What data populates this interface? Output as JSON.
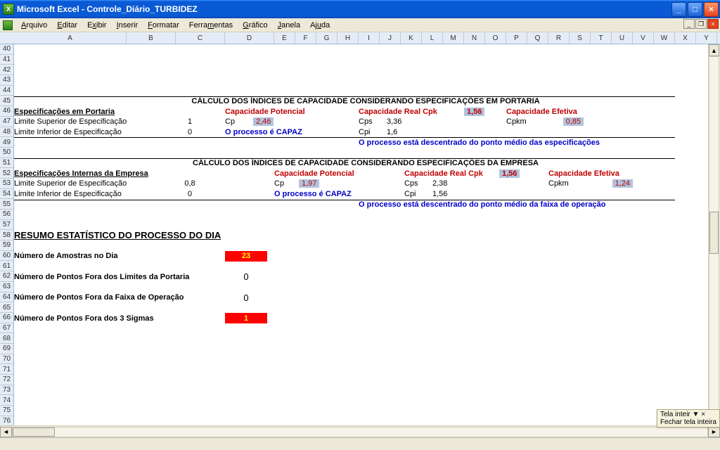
{
  "title": "Microsoft Excel - Controle_Diário_TURBIDEZ",
  "menus": [
    "Arquivo",
    "Editar",
    "Exibir",
    "Inserir",
    "Formatar",
    "Ferramentas",
    "Gráfico",
    "Janela",
    "Ajuda"
  ],
  "cols": [
    "A",
    "B",
    "C",
    "D",
    "E",
    "F",
    "G",
    "H",
    "I",
    "J",
    "K",
    "L",
    "M",
    "N",
    "O",
    "P",
    "Q",
    "R",
    "S",
    "T",
    "U",
    "V",
    "W",
    "X",
    "Y"
  ],
  "rows_start": 40,
  "rows_end": 76,
  "line45": "CÁLCULO DOS ÍNDICES DE CAPACIDADE CONSIDERANDO ESPECIFICAÇÕES EM PORTARIA",
  "line51": "CÁLCULO DOS ÍNDICES DE CAPACIDADE CONSIDERANDO ESPECIFICAÇÕES DA EMPRESA",
  "block1": {
    "spec_title": "Especificações em Portaria",
    "lse_label": "Limite Superior de Especificação",
    "lse_val": "1",
    "lie_label": "Limite Inferior de Especificação",
    "lie_val": "0",
    "cap_pot_label": "Capacidade Potencial",
    "cap_real_label": "Capacidade Real Cpk",
    "cap_real_val": "1,56",
    "cap_ef_label": "Capacidade Efetiva",
    "cp_label": "Cp",
    "cp_val": "2,46",
    "cps_label": "Cps",
    "cps_val": "3,36",
    "cpkm_label": "Cpkm",
    "cpkm_val": "0,85",
    "capaz": "O processo é CAPAZ",
    "cpi_label": "Cpi",
    "cpi_val": "1,6",
    "descentrado": "O processo está descentrado do ponto médio das especificações"
  },
  "block2": {
    "spec_title": "Especificações Internas da Empresa",
    "lse_label": "Limite Superior de Especificação",
    "lse_val": "0,8",
    "lie_label": "Limite Inferior de Especificação",
    "lie_val": "0",
    "cap_pot_label": "Capacidade Potencial",
    "cap_real_label": "Capacidade Real Cpk",
    "cap_real_val": "1,56",
    "cap_ef_label": "Capacidade Efetiva",
    "cp_label": "Cp",
    "cp_val": "1,97",
    "cps_label": "Cps",
    "cps_val": "2,38",
    "cpkm_label": "Cpkm",
    "cpkm_val": "1,24",
    "capaz": "O processo é CAPAZ",
    "cpi_label": "Cpi",
    "cpi_val": "1,56",
    "descentrado": "O processo está descentrado do ponto médio da faixa de operação"
  },
  "resumo_title": "RESUMO ESTATÍSTICO DO PROCESSO DO DIA",
  "r60_label": "Número de Amostras no Dia",
  "r60_val": "23",
  "r62_label": "Número de Pontos Fora dos Limites da Portaria",
  "r62_val": "0",
  "r64_label": "Número de Pontos Fora da Faixa de Operação",
  "r64_val": "0",
  "r66_label": "Número de Pontos Fora dos 3 Sigmas",
  "r66_val": "1",
  "float_top": "Tela inteir  ▼  ×",
  "float_bot": "Fechar tela inteira"
}
